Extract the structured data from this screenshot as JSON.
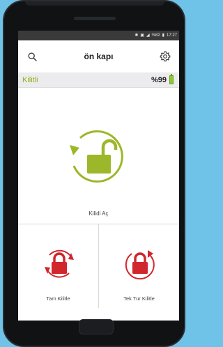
{
  "status_bar": {
    "bluetooth_icon": "bluetooth-icon",
    "signal_icon": "signal-icon",
    "battery_text": "%82",
    "time": "17:27"
  },
  "header": {
    "title": "ön kapı",
    "search_icon": "search-icon",
    "settings_icon": "gear-icon"
  },
  "lock_status": {
    "state": "Kilitli",
    "battery": "%99",
    "state_color": "#8db020"
  },
  "actions": {
    "unlock_label": "Kilidi Aç",
    "full_lock_label": "Tam Kilitle",
    "single_lock_label": "Tek Tur Kilitle"
  },
  "colors": {
    "unlock_green": "#9cb729",
    "lock_red": "#d0262c"
  }
}
